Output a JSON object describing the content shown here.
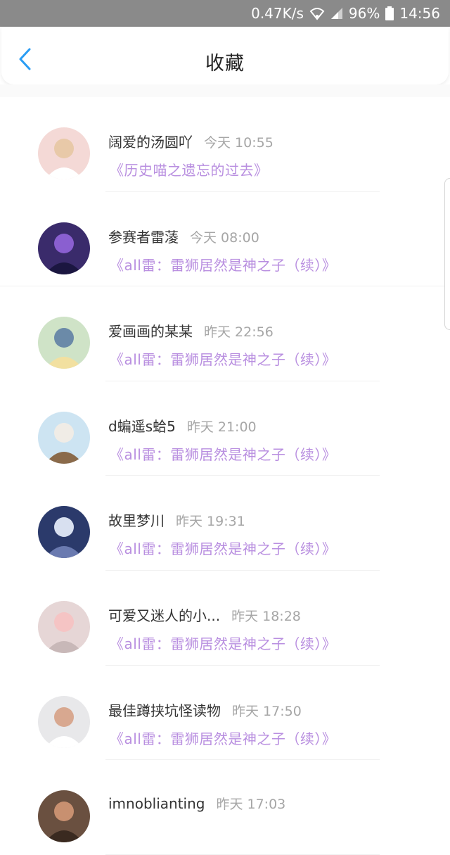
{
  "status_bar": {
    "speed": "0.47K/s",
    "battery": "96%",
    "time": "14:56",
    "icons": [
      "wifi-icon",
      "signal-icon",
      "battery-icon"
    ]
  },
  "header": {
    "title": "收藏",
    "back_icon": "chevron-left-icon"
  },
  "colors": {
    "accent": "#2a9df4",
    "work_title": "#b98fe0",
    "time": "#a6a6a6"
  },
  "items": [
    {
      "name": "阔爱的汤圆吖",
      "time": "今天 10:55",
      "title": "《历史喵之遗忘的过去》"
    },
    {
      "name": "参赛者雷蓤",
      "time": "今天 08:00",
      "title": "《all雷：雷狮居然是神之子（续）》"
    },
    {
      "name": "爱画画的某某",
      "time": "昨天 22:56",
      "title": "《all雷：雷狮居然是神之子（续）》"
    },
    {
      "name": "d蝙遥s蛤5",
      "time": "昨天 21:00",
      "title": "《all雷：雷狮居然是神之子（续）》"
    },
    {
      "name": "故里梦川",
      "time": "昨天 19:31",
      "title": "《all雷：雷狮居然是神之子（续）》"
    },
    {
      "name": "可爱又迷人的小...",
      "time": "昨天 18:28",
      "title": "《all雷：雷狮居然是神之子（续）》"
    },
    {
      "name": "最佳蹲挟坑怪读物",
      "time": "昨天 17:50",
      "title": "《all雷：雷狮居然是神之子（续）》"
    },
    {
      "name": "imnoblianting",
      "time": "昨天 17:03",
      "title": ""
    }
  ]
}
